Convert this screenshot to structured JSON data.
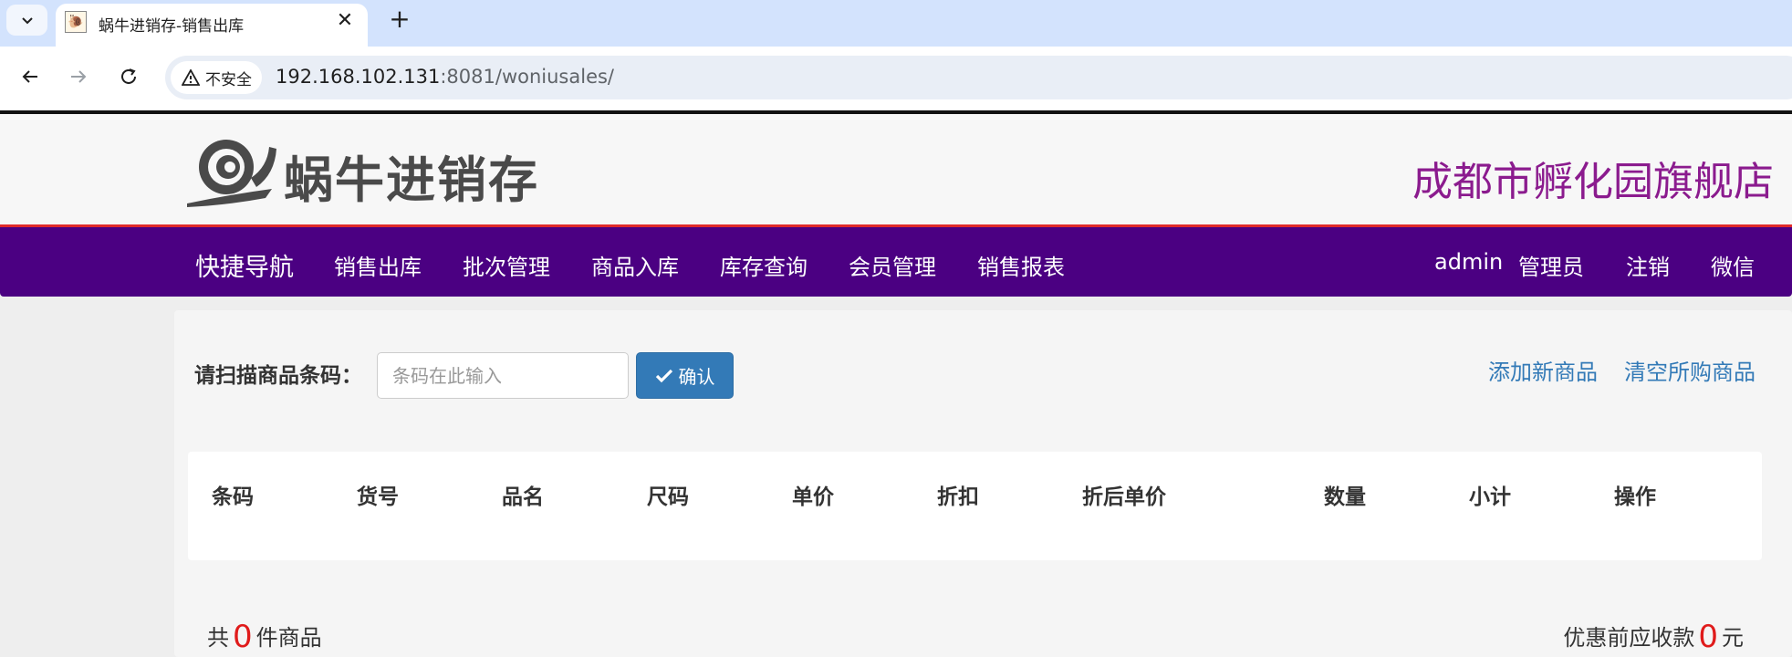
{
  "browser": {
    "tab_title": "蜗牛进销存-销售出库",
    "security_label": "不安全",
    "url_host": "192.168.102.131",
    "url_rest": ":8081/woniusales/"
  },
  "header": {
    "logo_text": "蜗牛进销存",
    "store_name": "成都市孵化园旗舰店"
  },
  "nav": {
    "brand": "快捷导航",
    "items": [
      "销售出库",
      "批次管理",
      "商品入库",
      "库存查询",
      "会员管理",
      "销售报表"
    ],
    "user": "admin",
    "role": "管理员",
    "logout": "注销",
    "wechat": "微信"
  },
  "scan": {
    "label": "请扫描商品条码：",
    "placeholder": "条码在此输入",
    "confirm_label": "确认",
    "add_product": "添加新商品",
    "clear_cart": "清空所购商品"
  },
  "table": {
    "columns": [
      "条码",
      "货号",
      "品名",
      "尺码",
      "单价",
      "折扣",
      "折后单价",
      "数量",
      "小计",
      "操作"
    ]
  },
  "summary": {
    "prefix": "共",
    "count": "0",
    "suffix": "件商品",
    "total_label": "优惠前应收款",
    "total_value": "0",
    "currency": "元"
  },
  "colors": {
    "nav_bg": "#4b0082",
    "store_name": "#8b1b8e",
    "link": "#337ab7",
    "highlight_number": "#e01b1b"
  }
}
